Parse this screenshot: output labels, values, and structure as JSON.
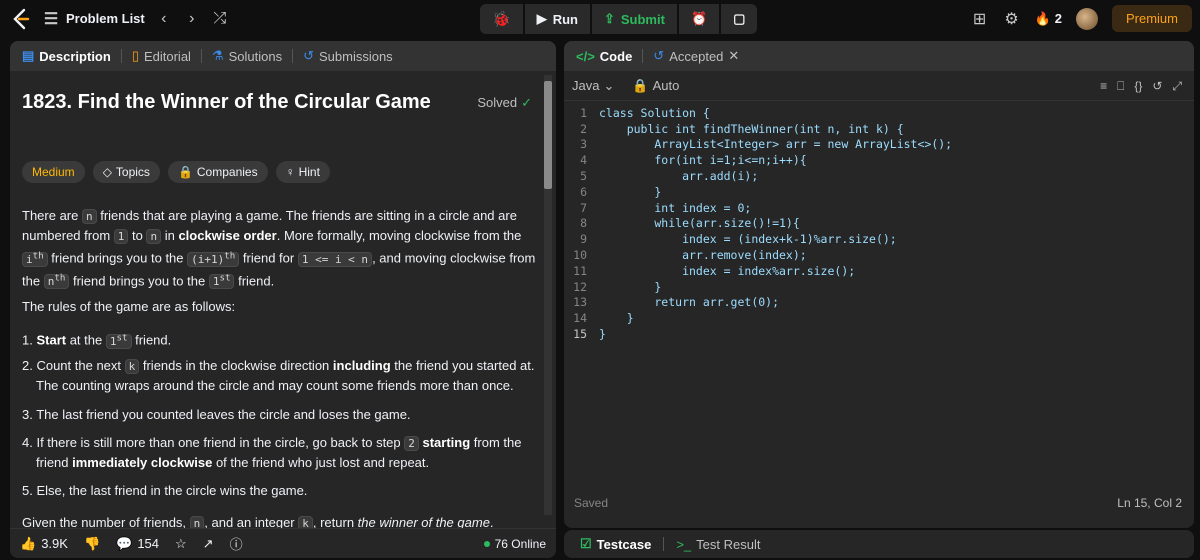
{
  "topbar": {
    "problem_list": "Problem List",
    "run": "Run",
    "submit": "Submit",
    "streak": "2",
    "premium": "Premium"
  },
  "left_tabs": {
    "description": "Description",
    "editorial": "Editorial",
    "solutions": "Solutions",
    "submissions": "Submissions"
  },
  "problem": {
    "title": "1823. Find the Winner of the Circular Game",
    "solved": "Solved",
    "difficulty": "Medium",
    "topics": "Topics",
    "companies": "Companies",
    "hint": "Hint"
  },
  "footer": {
    "likes": "3.9K",
    "comments": "154",
    "online": "76 Online"
  },
  "editor": {
    "code_tab": "Code",
    "accepted_tab": "Accepted",
    "language": "Java",
    "auto": "Auto",
    "saved": "Saved",
    "position": "Ln 15, Col 2",
    "lines": [
      "class Solution {",
      "    public int findTheWinner(int n, int k) {",
      "        ArrayList<Integer> arr = new ArrayList<>();",
      "        for(int i=1;i<=n;i++){",
      "            arr.add(i);",
      "        }",
      "        int index = 0;",
      "        while(arr.size()!=1){",
      "            index = (index+k-1)%arr.size();",
      "            arr.remove(index);",
      "            index = index%arr.size();",
      "        }",
      "        return arr.get(0);",
      "    }",
      "}"
    ]
  },
  "bottom": {
    "testcase": "Testcase",
    "test_result": "Test Result"
  },
  "colors": {
    "accent_green": "#2cbb5d",
    "accent_orange": "#ffa116",
    "accent_blue": "#3c8ae8",
    "difficulty_medium": "#ffb800"
  }
}
